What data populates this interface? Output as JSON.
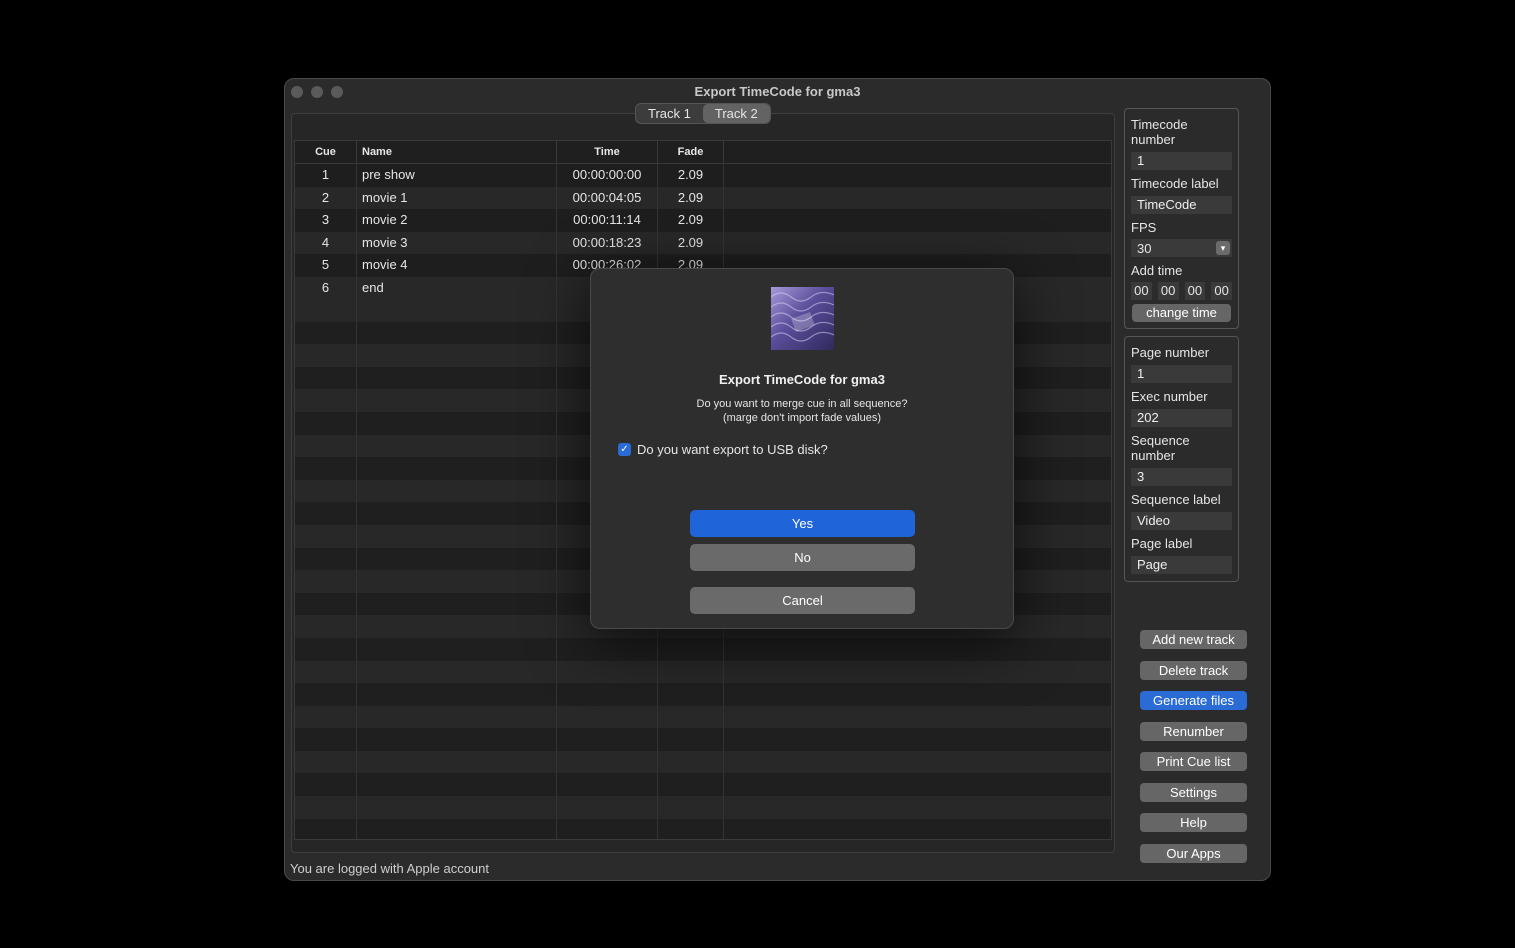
{
  "window": {
    "title": "Export TimeCode for gma3",
    "status": "You are logged with Apple account"
  },
  "tabs": [
    "Track 1",
    "Track 2"
  ],
  "active_tab": "Track 2",
  "table": {
    "headers": {
      "cue": "Cue",
      "name": "Name",
      "time": "Time",
      "fade": "Fade"
    },
    "rows": [
      {
        "cue": "1",
        "name": "pre show",
        "time": "00:00:00:00",
        "fade": "2.09"
      },
      {
        "cue": "2",
        "name": "movie 1",
        "time": "00:00:04:05",
        "fade": "2.09"
      },
      {
        "cue": "3",
        "name": "movie 2",
        "time": "00:00:11:14",
        "fade": "2.09"
      },
      {
        "cue": "4",
        "name": "movie 3",
        "time": "00:00:18:23",
        "fade": "2.09"
      },
      {
        "cue": "5",
        "name": "movie 4",
        "time": "00:00:26:02",
        "fade": "2.09"
      },
      {
        "cue": "6",
        "name": "end",
        "time": "00:",
        "fade": ""
      }
    ]
  },
  "timecode_panel": {
    "tc_number_label": "Timecode number",
    "tc_number": "1",
    "tc_label_label": "Timecode label",
    "tc_label": "TimeCode",
    "fps_label": "FPS",
    "fps": "30",
    "add_time_label": "Add time",
    "add_time": [
      "00",
      "00",
      "00",
      "00"
    ],
    "change_time": "change time"
  },
  "sequence_panel": {
    "page_number_label": "Page number",
    "page_number": "1",
    "exec_number_label": "Exec number",
    "exec_number": "202",
    "seq_number_label": "Sequence number",
    "seq_number": "3",
    "seq_label_label": "Sequence label",
    "seq_label": "Video",
    "page_label_label": "Page label",
    "page_label": "Page"
  },
  "side_buttons": {
    "add_track": "Add new track",
    "delete_track": "Delete track",
    "generate": "Generate files",
    "renumber": "Renumber",
    "print": "Print Cue list",
    "settings": "Settings",
    "help": "Help",
    "apps": "Our Apps"
  },
  "dialog": {
    "title": "Export TimeCode for gma3",
    "message_line1": "Do you want to merge cue in all sequence?",
    "message_line2": "(marge don't import fade values)",
    "checkbox_label": "Do you want export to USB disk?",
    "checkbox_checked": true,
    "yes": "Yes",
    "no": "No",
    "cancel": "Cancel"
  },
  "colors": {
    "accent": "#2a6bd6",
    "background": "#2b2b2b"
  }
}
